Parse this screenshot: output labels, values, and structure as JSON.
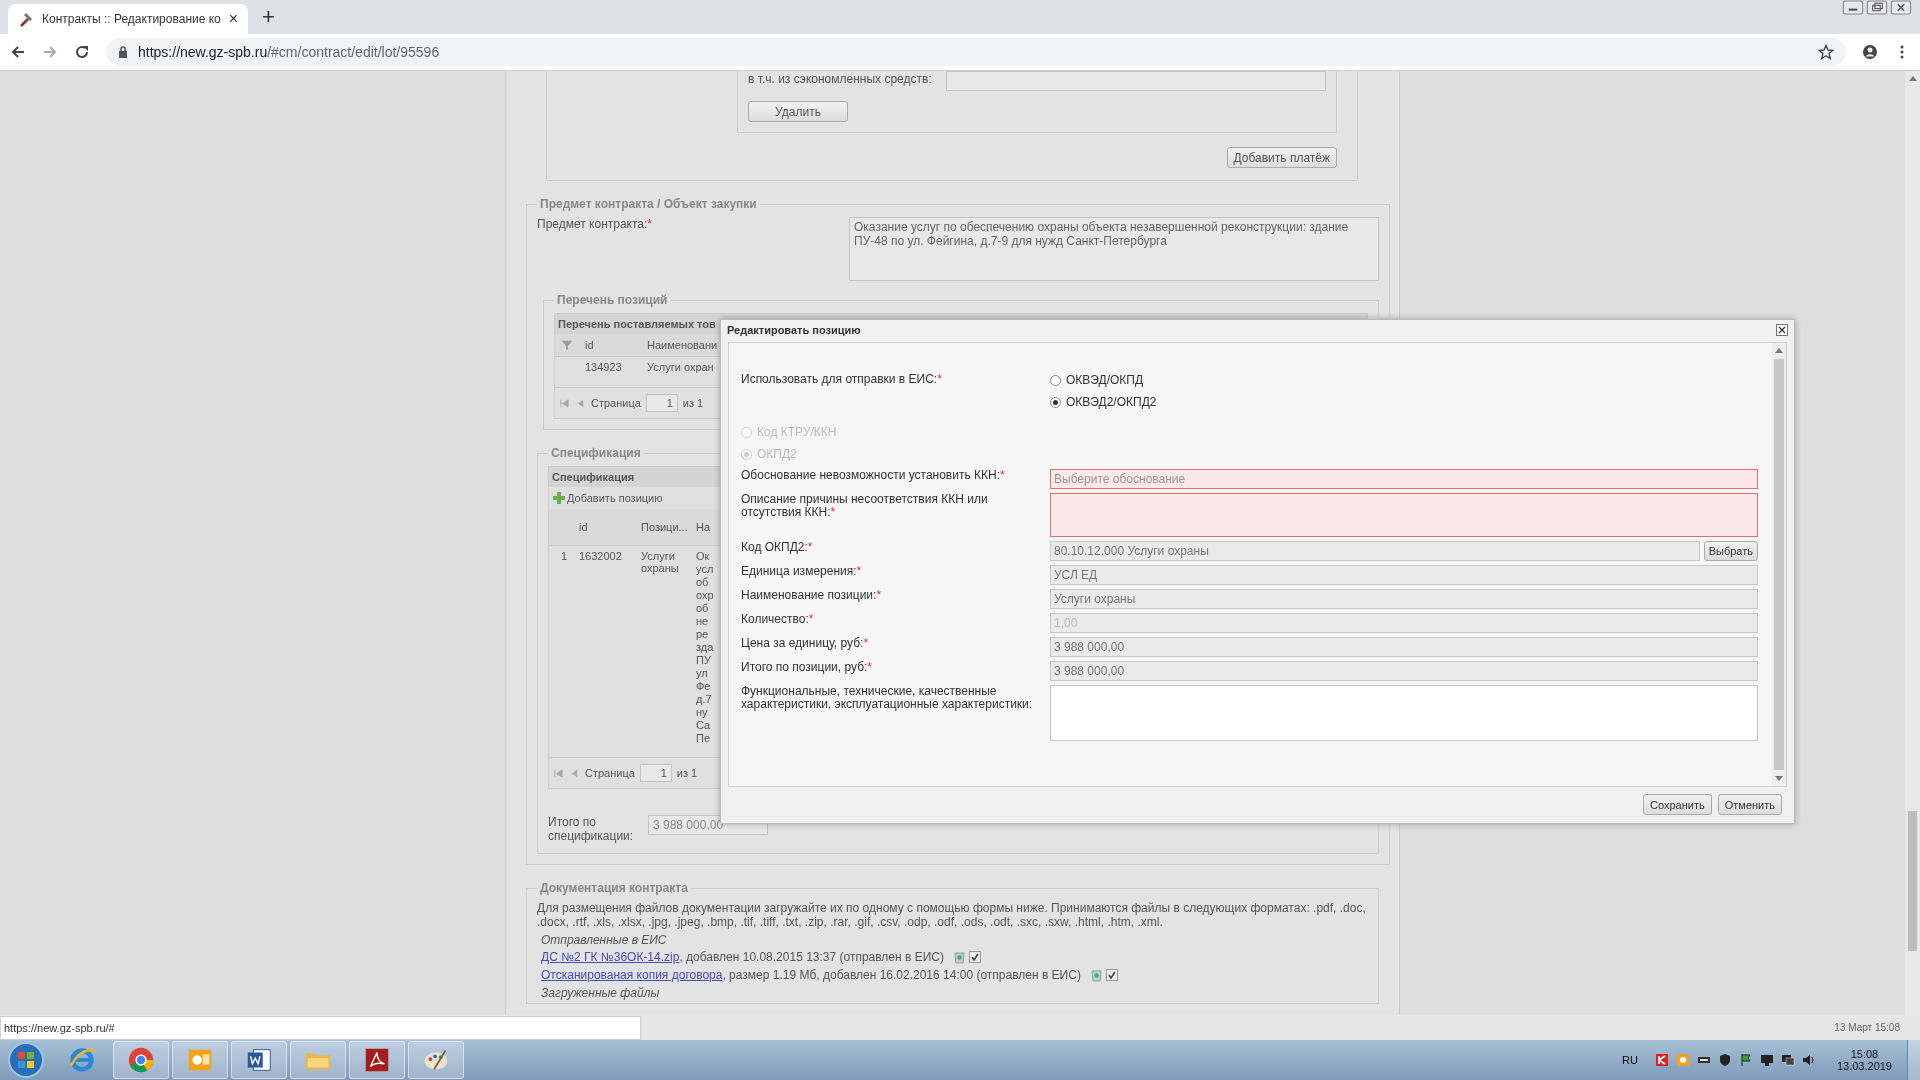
{
  "browser": {
    "tab_title": "Контракты :: Редактирование ко",
    "tab_close": "×",
    "new_tab": "+",
    "url_host": "https://new.gz-spb.ru",
    "url_path": "/#cm/contract/edit/lot/95596"
  },
  "required_mark": "*",
  "page": {
    "payment": {
      "label": "в т.ч. из сэкономленных средств:",
      "delete_button": "Удалить",
      "add_button": "Добавить платёж"
    },
    "subject": {
      "legend": "Предмет контракта / Объект закупки",
      "label": "Предмет контракта:",
      "required": true,
      "value": "Оказание услуг по обеспечению охраны объекта незавершенной реконструкции: здание ПУ-48 по ул. Фейгина, д.7-9 для нужд Санкт-Петербурга"
    },
    "positions": {
      "legend": "Перечень позиций",
      "grid_title": "Перечень поставляемых тов",
      "columns": [
        "id",
        "Наименовани"
      ],
      "rows": [
        [
          "134923",
          "Услуги охран"
        ]
      ],
      "pager": {
        "label": "Страница",
        "page": "1",
        "of": "из 1"
      }
    },
    "specification": {
      "legend": "Спецификация",
      "grid_title": "Спецификация",
      "add_button": "Добавить позицию",
      "columns": [
        "id",
        "Позици...",
        "На"
      ],
      "rows": [
        {
          "number": "1",
          "cells": [
            "1632002",
            "Услуги охраны",
            "Ок усл об охр об не ре зда ПУ ул Фе д.7 ну Са Пе"
          ]
        }
      ],
      "pager": {
        "label": "Страница",
        "page": "1",
        "of": "из 1"
      },
      "total_label": "Итого по спецификации:",
      "total_value": "3 988 000,00"
    },
    "documents": {
      "legend": "Документация контракта",
      "note": "Для размещения файлов документации загружайте их по одному с помощью формы ниже. Принимаются файлы в следующих форматах: .pdf, .doc, .docx, .rtf, .xls, .xlsx, .jpg, .jpeg, .bmp, .tif, .tiff, .txt, .zip, .rar, .gif, .csv, .odp, .odf, .ods, .odt, .sxc, .sxw, .html, .htm, .xml.",
      "sent_heading": "Отправленные в ЕИС",
      "files": [
        {
          "link": "ДС №2 ГК №36ОК-14.zip",
          "details": ", добавлен 10.08.2015 13:37 (отправлен в ЕИС)",
          "checked": true
        },
        {
          "link": "Отсканированая копия договора",
          "details": ", размер 1.19 Мб, добавлен 16.02.2016 14:00 (отправлен в ЕИС)",
          "checked": true
        }
      ],
      "uploaded_heading": "Загруженные файлы"
    }
  },
  "dialog": {
    "title": "Редактировать позицию",
    "send_label": "Использовать для отправки в ЕИС:",
    "send_required": true,
    "send_options": [
      {
        "label": "ОКВЭД/ОКПД",
        "selected": false
      },
      {
        "label": "ОКВЭД2/ОКПД2",
        "selected": true
      }
    ],
    "code_options": [
      {
        "label": "Код КТРУ/ККН",
        "selected": false,
        "disabled": true
      },
      {
        "label": "ОКПД2",
        "selected": true,
        "disabled": true
      }
    ],
    "fields": [
      {
        "kind": "select",
        "label": "Обоснование невозможности установить ККН:",
        "required": true,
        "invalid": true,
        "placeholder": "Выберите обоснование"
      },
      {
        "kind": "textarea",
        "label": "Описание причины несоответствия ККН или отсутствия ККН:",
        "required": true,
        "invalid": true
      },
      {
        "kind": "picker",
        "label": "Код ОКПД2:",
        "required": true,
        "invalid": false,
        "value": "80.10.12.000 Услуги охраны",
        "button": "Выбрать"
      },
      {
        "kind": "text",
        "label": "Единица измерения:",
        "required": true,
        "invalid": false,
        "value": "УСЛ ЕД"
      },
      {
        "kind": "text",
        "label": "Наименование позиции:",
        "required": true,
        "invalid": false,
        "value": "Услуги охраны"
      },
      {
        "kind": "text",
        "label": "Количество:",
        "required": true,
        "invalid": false,
        "disabled": true,
        "value": "1,00"
      },
      {
        "kind": "text",
        "label": "Цена за единицу, руб:",
        "required": true,
        "invalid": false,
        "value": "3 988 000,00"
      },
      {
        "kind": "text",
        "label": "Итого по позиции, руб:",
        "required": true,
        "invalid": false,
        "value": "3 988 000,00"
      },
      {
        "kind": "textarea",
        "label": "Функциональные, технические, качественные характеристики, эксплуатационные характеристики:",
        "required": false,
        "invalid": false,
        "white": true
      }
    ],
    "buttons": [
      "Сохранить",
      "Отменить"
    ]
  },
  "status_link": "https://new.gz-spb.ru/#",
  "page_clock": "13 Март 15:08",
  "taskbar": {
    "language": "RU",
    "time": "15:08",
    "date": "13.03.2019"
  }
}
